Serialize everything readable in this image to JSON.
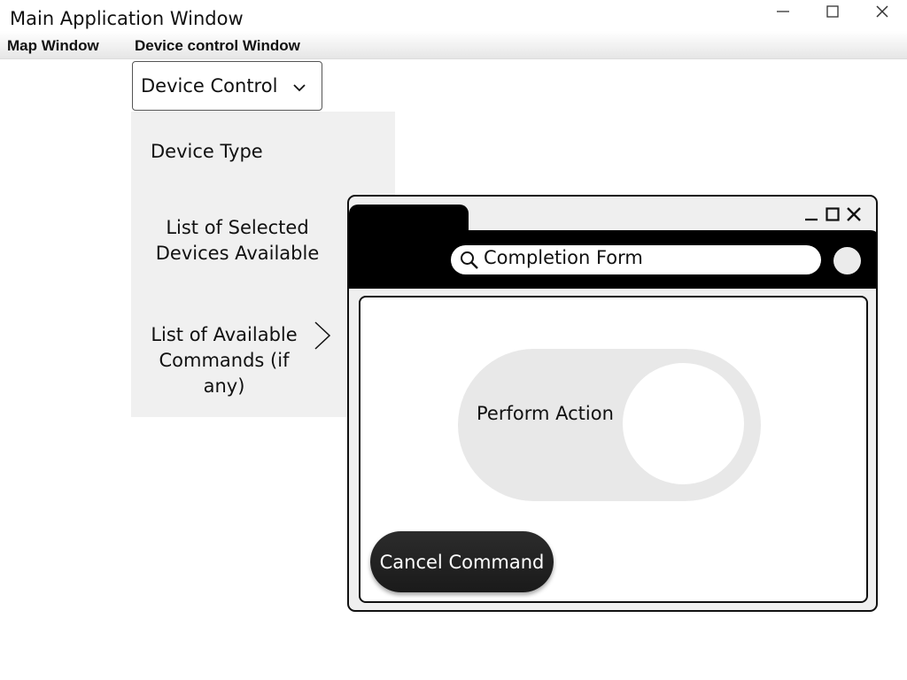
{
  "window": {
    "title": "Main Application Window",
    "controls": [
      "minimize-icon",
      "maximize-icon",
      "close-icon"
    ]
  },
  "menubar": {
    "items": [
      "Map Window",
      "Device control Window"
    ]
  },
  "device_control": {
    "dropdown_value": "Device Control",
    "items": {
      "device_type": "Device Type",
      "selected_devices": "List of Selected Devices Available",
      "available_commands": "List of Available Commands (if any)"
    }
  },
  "completion_form": {
    "controls": [
      "minimize-icon",
      "maximize-icon",
      "close-icon"
    ],
    "search_text": "Completion Form",
    "toggle_label": "Perform Action",
    "cancel_label": "Cancel Command"
  },
  "colors": {
    "popup_header": "#000000",
    "panel_bg": "#f0f0f0",
    "toggle_bg": "#e8e8e8",
    "cancel_button": "#222222"
  }
}
